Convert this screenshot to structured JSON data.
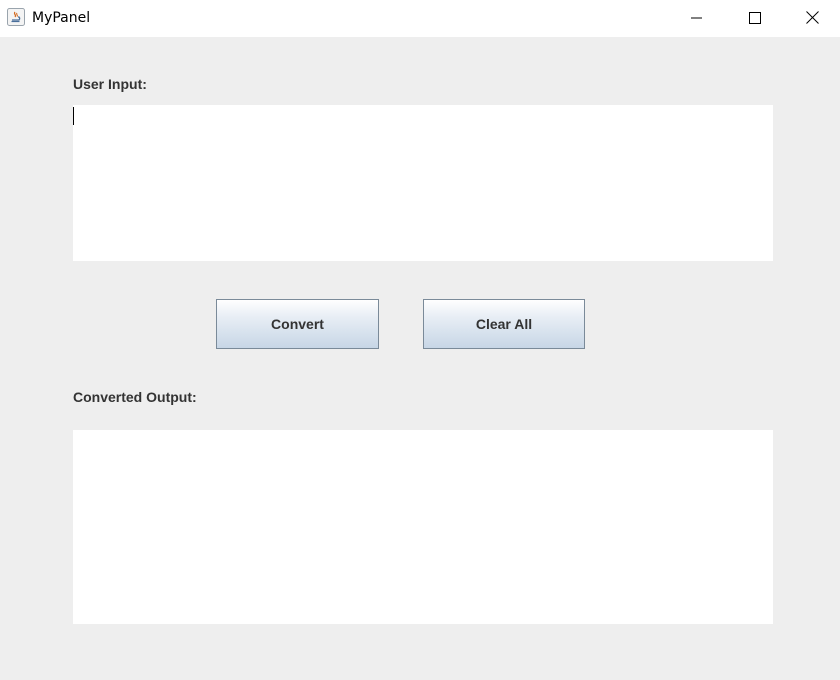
{
  "window": {
    "title": "MyPanel",
    "app_icon": "java-icon",
    "controls": {
      "minimize_icon": "minimize-icon",
      "maximize_icon": "maximize-icon",
      "close_icon": "close-icon"
    }
  },
  "form": {
    "input_label": "User Input:",
    "input_value": "",
    "output_label": "Converted Output:",
    "output_value": ""
  },
  "buttons": {
    "convert_label": "Convert",
    "clear_label": "Clear All"
  }
}
